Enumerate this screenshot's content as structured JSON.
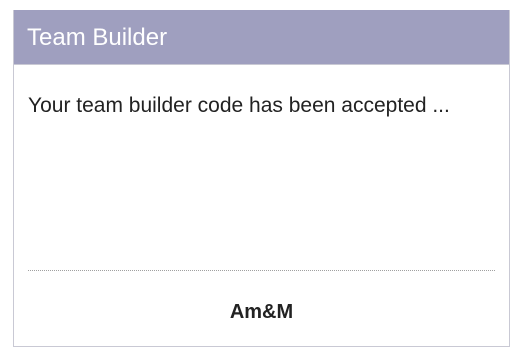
{
  "panel": {
    "title": "Team Builder",
    "message": "Your team builder code has been accepted ...",
    "footer": "Am&M"
  },
  "colors": {
    "header_bg": "#9f9fbf",
    "header_text": "#ffffff",
    "border": "#c9c9d4"
  }
}
